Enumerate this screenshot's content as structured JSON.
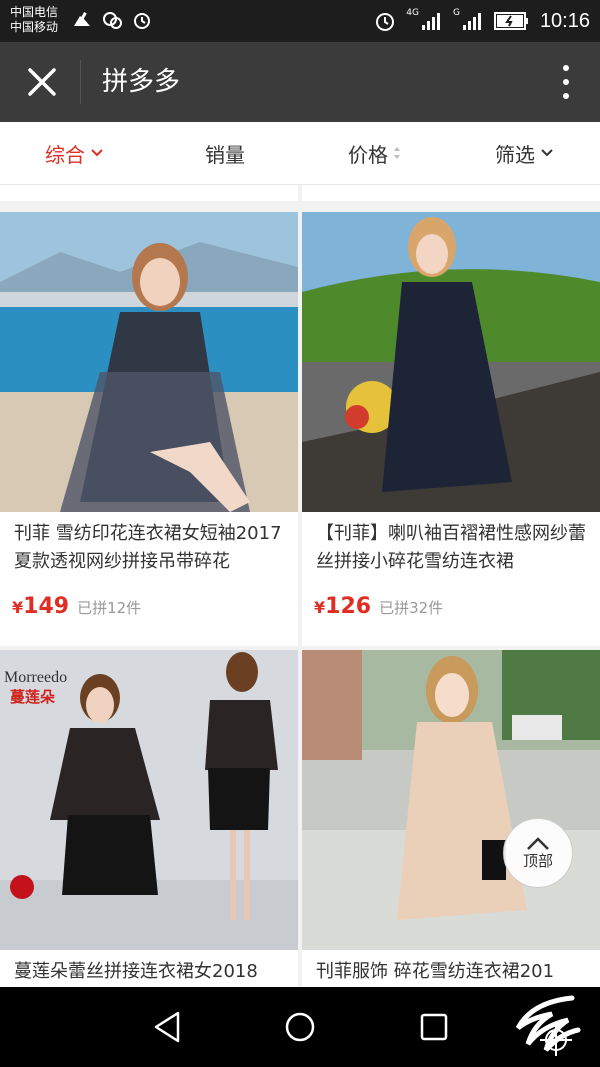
{
  "status_bar": {
    "carrier_1": "中国电信",
    "carrier_2": "中国移动",
    "network_1": "4G",
    "network_2": "G",
    "time": "10:16"
  },
  "app_bar": {
    "title": "拼多多"
  },
  "sort_bar": {
    "items": [
      {
        "label": "综合",
        "icon": "chevron-down-icon",
        "active": true
      },
      {
        "label": "销量",
        "icon": "",
        "active": false
      },
      {
        "label": "价格",
        "icon": "sort-updown-icon",
        "active": false
      },
      {
        "label": "筛选",
        "icon": "chevron-down-icon",
        "active": false
      }
    ]
  },
  "products": [
    {
      "name": "刊菲 雪纺印花连衣裙女短袖2017夏款透视网纱拼接吊带碎花",
      "currency": "¥",
      "price": "149",
      "sold": "已拼12件"
    },
    {
      "name": "【刊菲】喇叭袖百褶裙性感网纱蕾丝拼接小碎花雪纺连衣裙",
      "currency": "¥",
      "price": "126",
      "sold": "已拼32件"
    },
    {
      "name": "蔓莲朵蕾丝拼接连衣裙女2018",
      "currency": "¥",
      "price": "",
      "sold": "",
      "brand_logo": "Morreedo 蔓莲朵"
    },
    {
      "name": "刊菲服饰 碎花雪纺连衣裙201",
      "currency": "¥",
      "price": "",
      "sold": ""
    }
  ],
  "back_to_top": {
    "label": "顶部"
  },
  "colors": {
    "accent": "#e02e24",
    "appbar": "#3b3b3b",
    "statusbar": "#1d1d1d"
  }
}
